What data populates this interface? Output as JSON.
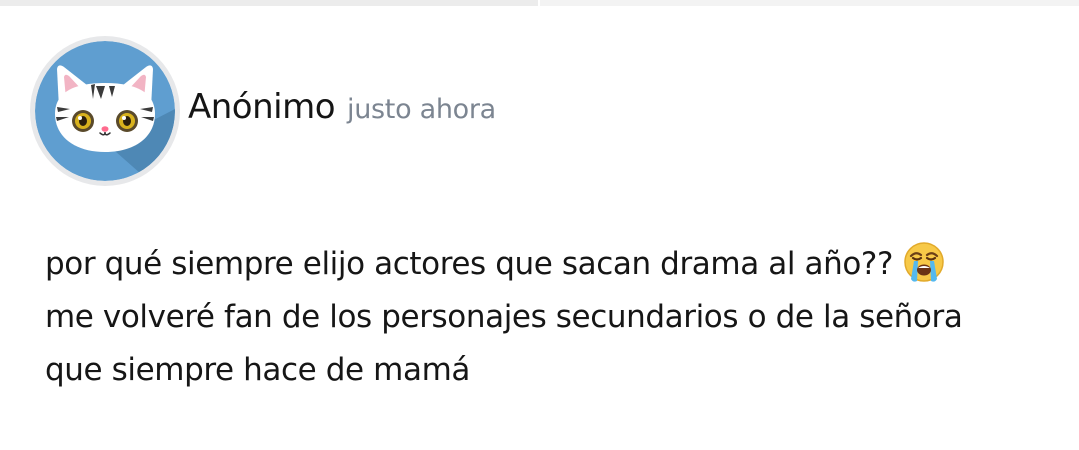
{
  "post": {
    "author": "Anónimo",
    "timestamp": "justo ahora",
    "avatar_icon": "cat-avatar-icon",
    "body_lines": [
      "por qué siempre elijo actores que sacan drama al año??",
      "me volveré fan de los personajes secundarios o de la señora",
      "que siempre hace de mamá"
    ],
    "emoji_icon": "loudly-crying-face-icon"
  },
  "colors": {
    "avatar_background": "#5f9ed0",
    "avatar_ring": "#e7e8ea",
    "timestamp": "#7c8591",
    "text": "#161616"
  }
}
